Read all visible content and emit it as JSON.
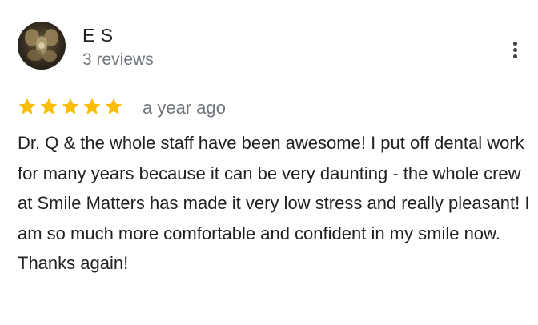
{
  "review": {
    "author_name": "E S",
    "review_count": "3 reviews",
    "rating": 5,
    "rating_max": 5,
    "time_ago": "a year ago",
    "text": "Dr. Q & the whole staff have been awesome! I put off dental work for many years because it can be very daunting - the whole crew at Smile Matters has made it very low stress and really pleasant! I am so much more comfortable and confident in my smile now. Thanks again!"
  },
  "icons": {
    "avatar": "profile-photo",
    "menu": "more-vertical-icon",
    "star": "star-icon"
  },
  "colors": {
    "star": "#fbbc04",
    "primary_text": "#202124",
    "secondary_text": "#70757a"
  }
}
